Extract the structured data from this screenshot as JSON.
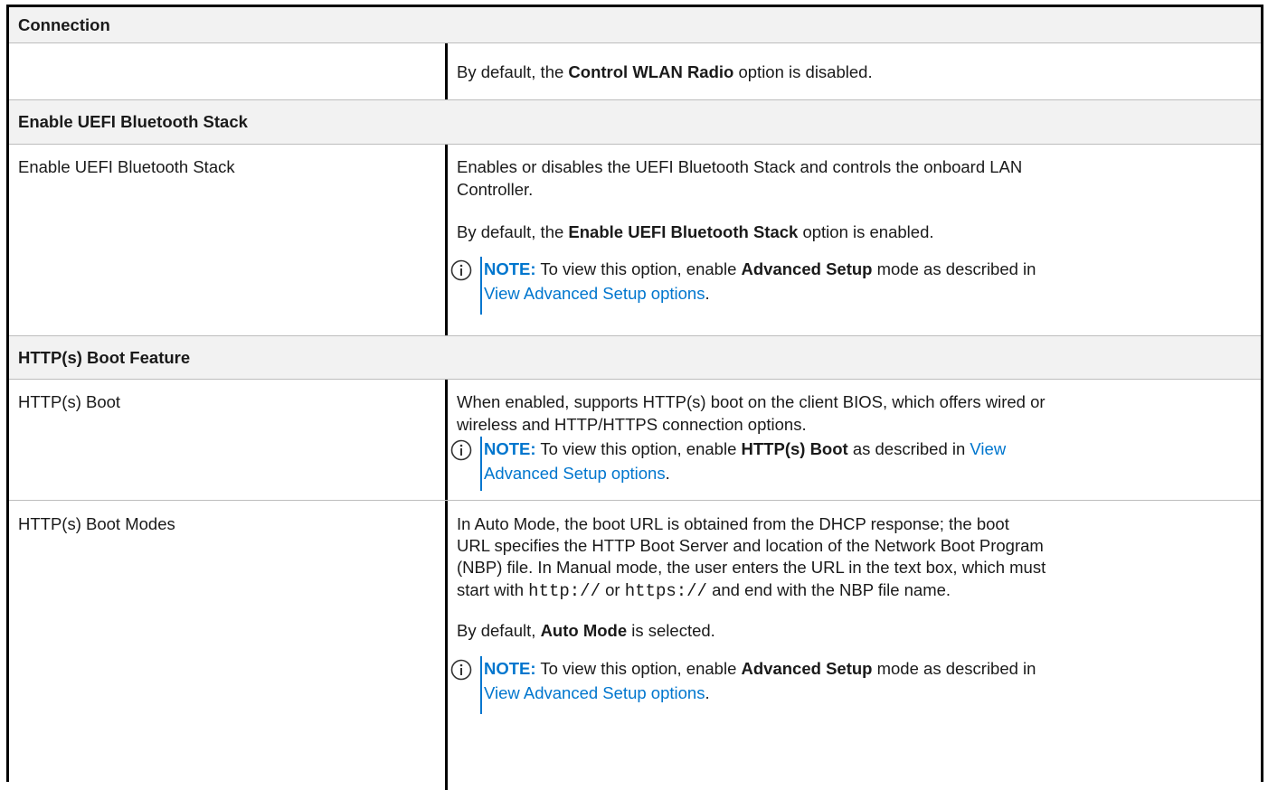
{
  "table": {
    "header_connection": "Connection",
    "row_wlan": {
      "p1_pre": "By default, the ",
      "p1_bold": "Control WLAN Radio",
      "p1_post": " option is disabled."
    },
    "header_bluetooth": "Enable UEFI Bluetooth Stack",
    "row_bluetooth": {
      "left": "Enable UEFI Bluetooth Stack",
      "p1_line1": "Enables or disables the UEFI Bluetooth Stack and controls the onboard LAN",
      "p1_line2": "Controller.",
      "p2_pre": "By default, the ",
      "p2_bold": "Enable UEFI Bluetooth Stack",
      "p2_post": " option is enabled.",
      "note_label": "NOTE:",
      "note_pre": " To view this option, enable ",
      "note_bold": "Advanced Setup",
      "note_post": " mode as described in",
      "note_link": "View Advanced Setup options",
      "note_end": "."
    },
    "header_http": "HTTP(s) Boot Feature",
    "row_http_boot": {
      "left": "HTTP(s) Boot",
      "p1_line1": "When enabled, supports HTTP(s) boot on the client BIOS, which offers wired or",
      "p1_line2": "wireless and HTTP/HTTPS connection options.",
      "note_label": "NOTE:",
      "note_pre": " To view this option, enable ",
      "note_bold": "HTTP(s) Boot",
      "note_post": " as described in ",
      "note_link1": "View",
      "note_link2": "Advanced Setup options",
      "note_end": "."
    },
    "row_http_modes": {
      "left": "HTTP(s) Boot Modes",
      "l1": "In Auto Mode, the boot URL is obtained from the DHCP response; the boot",
      "l2": "URL specifies the HTTP Boot Server and location of the Network Boot Program",
      "l3": "(NBP) file. In Manual mode, the user enters the URL in the text box, which must",
      "l4_pre": "start with ",
      "l4_code1": "http://",
      "l4_mid": " or ",
      "l4_code2": "https://",
      "l4_post": " and end with the NBP file name.",
      "p2_pre": "By default, ",
      "p2_bold": "Auto Mode",
      "p2_post": " is selected.",
      "note_label": "NOTE:",
      "note_pre": " To view this option, enable ",
      "note_bold": "Advanced Setup",
      "note_post": " mode as described in",
      "note_link": "View Advanced Setup options",
      "note_end": "."
    }
  },
  "colors": {
    "link": "#0076ce",
    "header_bg": "#f2f2f2",
    "border": "#000000"
  },
  "icons": {
    "note": "info-circle-icon"
  }
}
